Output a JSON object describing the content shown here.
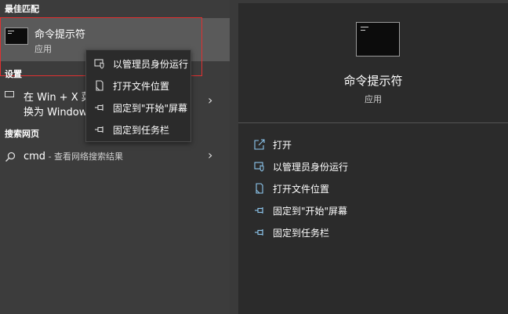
{
  "left": {
    "best_match": {
      "header": "最佳匹配",
      "title": "命令提示符",
      "subtitle": "应用"
    },
    "settings": {
      "header": "设置",
      "item_line1": "在 Win + X 菜",
      "item_line2": "换为 Window"
    },
    "web": {
      "header": "搜索网页",
      "query": "cmd",
      "suffix": " - 查看网络搜索结果"
    },
    "chevron": "›"
  },
  "context_menu": {
    "items": [
      {
        "label": "以管理员身份运行",
        "icon": "shield-window-icon"
      },
      {
        "label": "打开文件位置",
        "icon": "folder-file-icon"
      },
      {
        "label": "固定到\"开始\"屏幕",
        "icon": "pin-icon"
      },
      {
        "label": "固定到任务栏",
        "icon": "pin-icon"
      }
    ]
  },
  "preview": {
    "title": "命令提示符",
    "subtitle": "应用",
    "actions": [
      {
        "label": "打开",
        "icon": "open-icon"
      },
      {
        "label": "以管理员身份运行",
        "icon": "shield-window-icon"
      },
      {
        "label": "打开文件位置",
        "icon": "folder-file-icon"
      },
      {
        "label": "固定到\"开始\"屏幕",
        "icon": "pin-icon"
      },
      {
        "label": "固定到任务栏",
        "icon": "pin-icon"
      }
    ]
  },
  "colors": {
    "accent_icon": "#8ec8f0",
    "highlight_border": "#e03030",
    "left_bg": "#3c3c3c",
    "right_bg": "#2b2b2b",
    "selected_bg": "#5a5a5a"
  }
}
